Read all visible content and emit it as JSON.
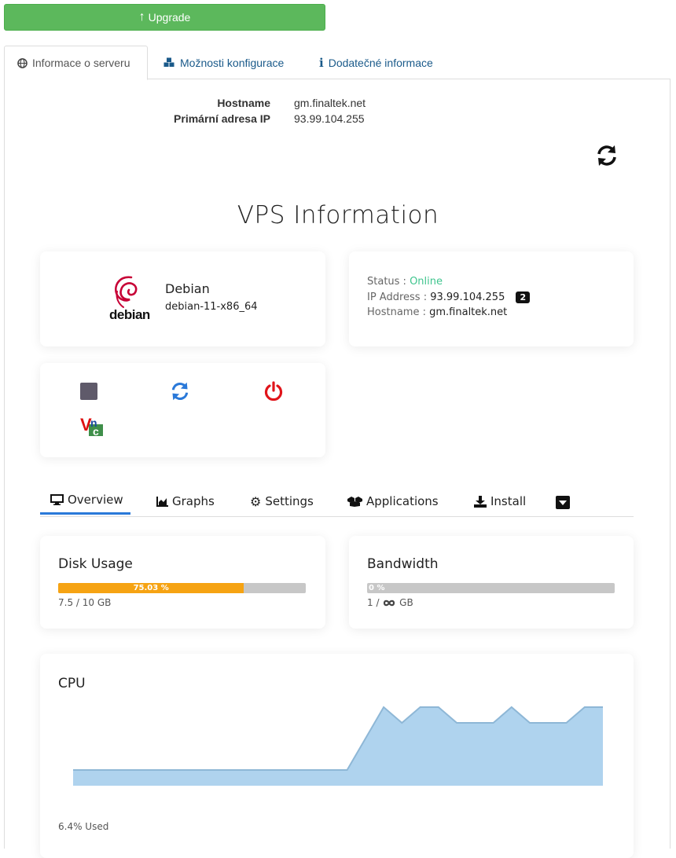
{
  "upgrade": {
    "label": "Upgrade"
  },
  "tabs": [
    {
      "label": "Informace o serveru",
      "icon": "globe-icon"
    },
    {
      "label": "Možnosti konfigurace",
      "icon": "cubes-icon"
    },
    {
      "label": "Dodatečné informace",
      "icon": "info-icon"
    }
  ],
  "server": {
    "hostname_label": "Hostname",
    "hostname_value": "gm.finaltek.net",
    "ip_label": "Primární adresa IP",
    "ip_value": "93.99.104.255"
  },
  "vps": {
    "title": "VPS Information",
    "os": {
      "logo_text": "debian",
      "name": "Debian",
      "version": "debian-11-x86_64"
    },
    "status": {
      "status_label": "Status :",
      "status_value": "Online",
      "ip_label": "IP Address :",
      "ip_value": "93.99.104.255",
      "ip_count": "2",
      "hostname_label": "Hostname :",
      "hostname_value": "gm.finaltek.net"
    },
    "actions": [
      {
        "name": "stop",
        "icon": "stop-icon",
        "color": "#5f5a6a"
      },
      {
        "name": "restart",
        "icon": "refresh-icon",
        "color": "#2a79d9"
      },
      {
        "name": "power-off",
        "icon": "power-icon",
        "color": "#e0141a"
      },
      {
        "name": "vnc",
        "icon": "vnc-icon"
      }
    ]
  },
  "subtabs": [
    {
      "label": "Overview",
      "icon": "monitor-icon",
      "active": true
    },
    {
      "label": "Graphs",
      "icon": "area-chart-icon"
    },
    {
      "label": "Settings",
      "icon": "gear-icon"
    },
    {
      "label": "Applications",
      "icon": "boxes-icon"
    },
    {
      "label": "Install",
      "icon": "download-icon"
    }
  ],
  "disk": {
    "title": "Disk Usage",
    "percent_label": "75.03 %",
    "percent": 75.03,
    "sub": "7.5 / 10 GB",
    "color": "#f6a313"
  },
  "bandwidth": {
    "title": "Bandwidth",
    "percent_label": "0 %",
    "percent": 0,
    "sub_used": "1 /",
    "sub_unit": "GB"
  },
  "cpu": {
    "title": "CPU",
    "footer": "6.4% Used",
    "chart_data": {
      "type": "area",
      "title": "CPU",
      "values": [
        1,
        1,
        1,
        1,
        1,
        1,
        1,
        1,
        1,
        1,
        1,
        1,
        1,
        1,
        1,
        1,
        3,
        5,
        4,
        5,
        5,
        4,
        4,
        4,
        5,
        4,
        4,
        4,
        5,
        5
      ],
      "fill": "#afd3ee",
      "stroke": "#8eb7d6",
      "ylim": [
        0,
        5.2
      ]
    }
  }
}
